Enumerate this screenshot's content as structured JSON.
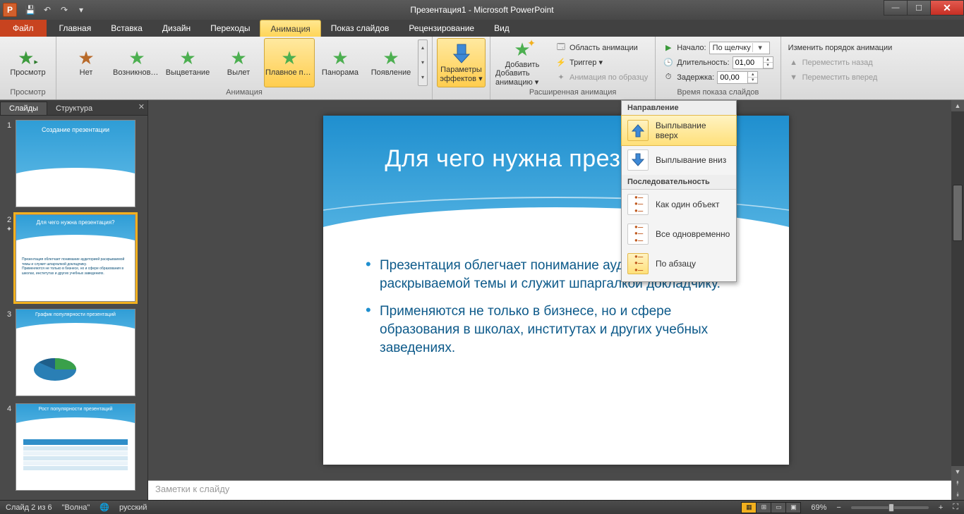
{
  "title": "Презентация1 - Microsoft PowerPoint",
  "app_letter": "P",
  "tabs": {
    "file": "Файл",
    "home": "Главная",
    "insert": "Вставка",
    "design": "Дизайн",
    "transitions": "Переходы",
    "animations": "Анимация",
    "slideshow": "Показ слайдов",
    "review": "Рецензирование",
    "view": "Вид"
  },
  "ribbon": {
    "preview": {
      "button": "Просмотр",
      "group": "Просмотр"
    },
    "animation": {
      "group": "Анимация",
      "items": {
        "none": "Нет",
        "appear": "Возникнове...",
        "fade": "Выцветание",
        "flyin": "Вылет",
        "floatin": "Плавное пр...",
        "split": "Панорама",
        "wipe": "Появление"
      }
    },
    "effectopts": {
      "label": "Параметры эффектов",
      "l1": "Параметры",
      "l2": "эффектов ▾"
    },
    "advanced": {
      "group": "Расширенная анимация",
      "add": "Добавить анимацию ▾",
      "pane": "Область анимации",
      "trigger": "Триггер ▾",
      "painter": "Анимация по образцу"
    },
    "timing": {
      "group": "Время показа слайдов",
      "start": "Начало:",
      "start_value": "По щелчку",
      "duration": "Длительность:",
      "duration_value": "01,00",
      "delay": "Задержка:",
      "delay_value": "00,00"
    },
    "reorder": {
      "title": "Изменить порядок анимации",
      "earlier": "Переместить назад",
      "later": "Переместить вперед"
    }
  },
  "dropdown": {
    "direction": "Направление",
    "float_up": "Выплывание вверх",
    "float_down": "Выплывание вниз",
    "sequence": "Последовательность",
    "as_one": "Как один объект",
    "all_at_once": "Все одновременно",
    "by_para": "По абзацу"
  },
  "sidepanel": {
    "slides_tab": "Слайды",
    "outline_tab": "Структура",
    "thumbs": [
      {
        "n": "1",
        "title": "Создание презентации"
      },
      {
        "n": "2",
        "title": "Для чего нужна презентация?"
      },
      {
        "n": "3",
        "title": "График популярности презентаций"
      },
      {
        "n": "4",
        "title": "Рост популярности презентаций"
      }
    ]
  },
  "slide": {
    "title": "Для чего нужна презентация?",
    "bullet1": "Презентация облегчает понимание аудиторией раскрываемой темы и служит шпаргалкой докладчику.",
    "bullet2": "Применяются не только в бизнесе, но и сфере образования в школах, институтах и других учебных заведениях."
  },
  "notes_placeholder": "Заметки к слайду",
  "status": {
    "slide": "Слайд 2 из 6",
    "theme": "\"Волна\"",
    "lang": "русский",
    "zoom": "69%"
  }
}
